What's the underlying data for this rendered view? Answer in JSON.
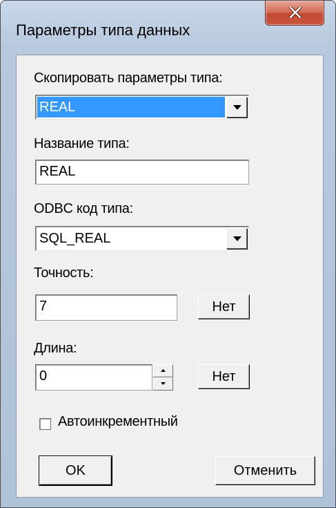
{
  "window": {
    "title": "Параметры типа данных",
    "close_icon": "close-icon"
  },
  "copy_params": {
    "label": "Скопировать параметры типа:",
    "value": "REAL"
  },
  "type_name": {
    "label": "Название типа:",
    "value": "REAL"
  },
  "odbc_code": {
    "label": "ODBC код типа:",
    "value": "SQL_REAL"
  },
  "precision": {
    "label": "Точность:",
    "value": "7",
    "button_label": "Нет"
  },
  "length": {
    "label": "Длина:",
    "value": "0",
    "button_label": "Нет"
  },
  "autoincrement": {
    "label": "Автоинкрементный",
    "checked": false
  },
  "buttons": {
    "ok": "OK",
    "cancel": "Отменить"
  },
  "colors": {
    "selection": "#3399ff",
    "close_button": "#c8553d",
    "frame": "#b7c9de"
  }
}
